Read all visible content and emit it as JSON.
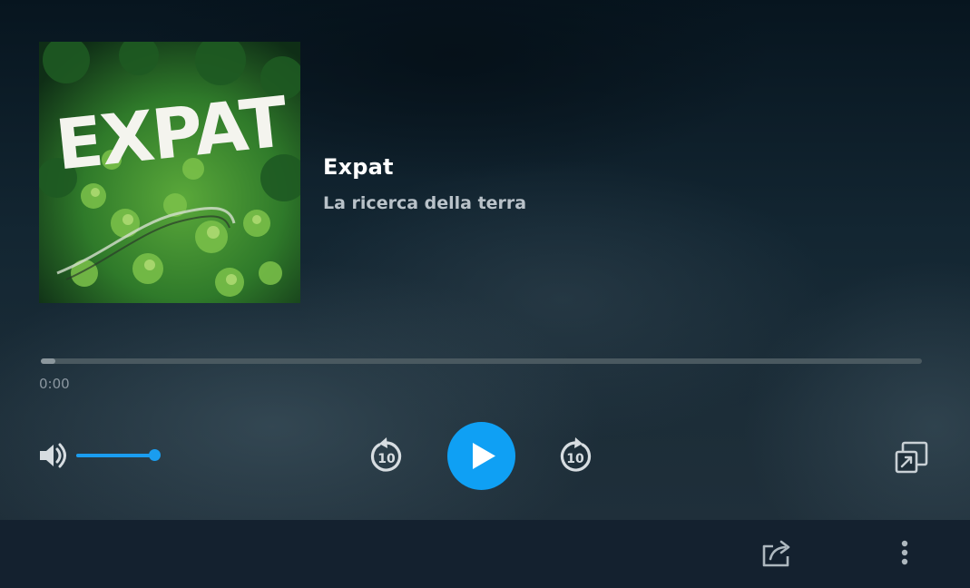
{
  "episode": {
    "cover_text": "EXPAT",
    "title": "Expat",
    "subtitle": "La ricerca della terra"
  },
  "playback": {
    "current_time": "0:00",
    "progress_fraction": 0.016,
    "skip_back_seconds": "10",
    "skip_forward_seconds": "10"
  },
  "volume": {
    "level_fraction": 1.0
  },
  "icons": {
    "volume": "volume-icon",
    "skip_back": "rewind-10-icon",
    "play": "play-icon",
    "skip_forward": "forward-10-icon",
    "popout": "popout-icon",
    "share": "share-icon",
    "more": "more-vertical-icon"
  },
  "colors": {
    "accent": "#0fa0f4",
    "footer": "#14212f",
    "icon": "#d7dde1"
  }
}
